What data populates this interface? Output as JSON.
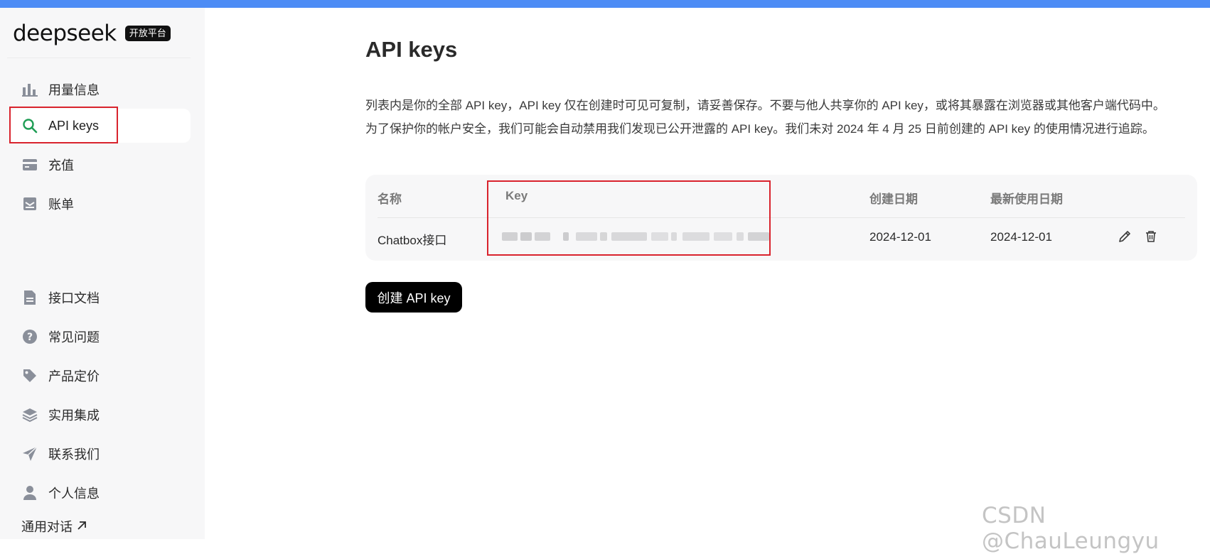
{
  "brand": {
    "name": "deepseek",
    "badge": "开放平台"
  },
  "sidebar": {
    "items": [
      {
        "label": "用量信息",
        "icon": "bar-chart-icon"
      },
      {
        "label": "API keys",
        "icon": "search-key-icon",
        "active": true
      },
      {
        "label": "充值",
        "icon": "wallet-card-icon"
      },
      {
        "label": "账单",
        "icon": "invoice-icon"
      },
      {
        "label": "接口文档",
        "icon": "document-icon"
      },
      {
        "label": "常见问题",
        "icon": "question-icon"
      },
      {
        "label": "产品定价",
        "icon": "price-tag-icon"
      },
      {
        "label": "实用集成",
        "icon": "layers-icon"
      },
      {
        "label": "联系我们",
        "icon": "paper-plane-icon"
      },
      {
        "label": "个人信息",
        "icon": "user-icon"
      }
    ],
    "bottom_link": {
      "label": "通用对话",
      "icon": "external-arrow-icon"
    }
  },
  "main": {
    "title": "API keys",
    "description_line1": "列表内是你的全部 API key，API key 仅在创建时可见可复制，请妥善保存。不要与他人共享你的 API key，或将其暴露在浏览器或其他客户端代码中。",
    "description_line2": "为了保护你的帐户安全，我们可能会自动禁用我们发现已公开泄露的 API key。我们未对 2024 年 4 月 25 日前创建的 API key 的使用情况进行追踪。",
    "table": {
      "headers": {
        "name": "名称",
        "key": "Key",
        "created": "创建日期",
        "last_used": "最新使用日期"
      },
      "rows": [
        {
          "name": "Chatbox接口",
          "created": "2024-12-01",
          "last_used": "2024-12-01"
        }
      ]
    },
    "create_button": "创建 API key"
  },
  "watermark": "CSDN @ChauLeungyu",
  "colors": {
    "accent_bar": "#4d8cf5",
    "active_icon": "#1f9d55",
    "highlight": "#d9232d"
  }
}
